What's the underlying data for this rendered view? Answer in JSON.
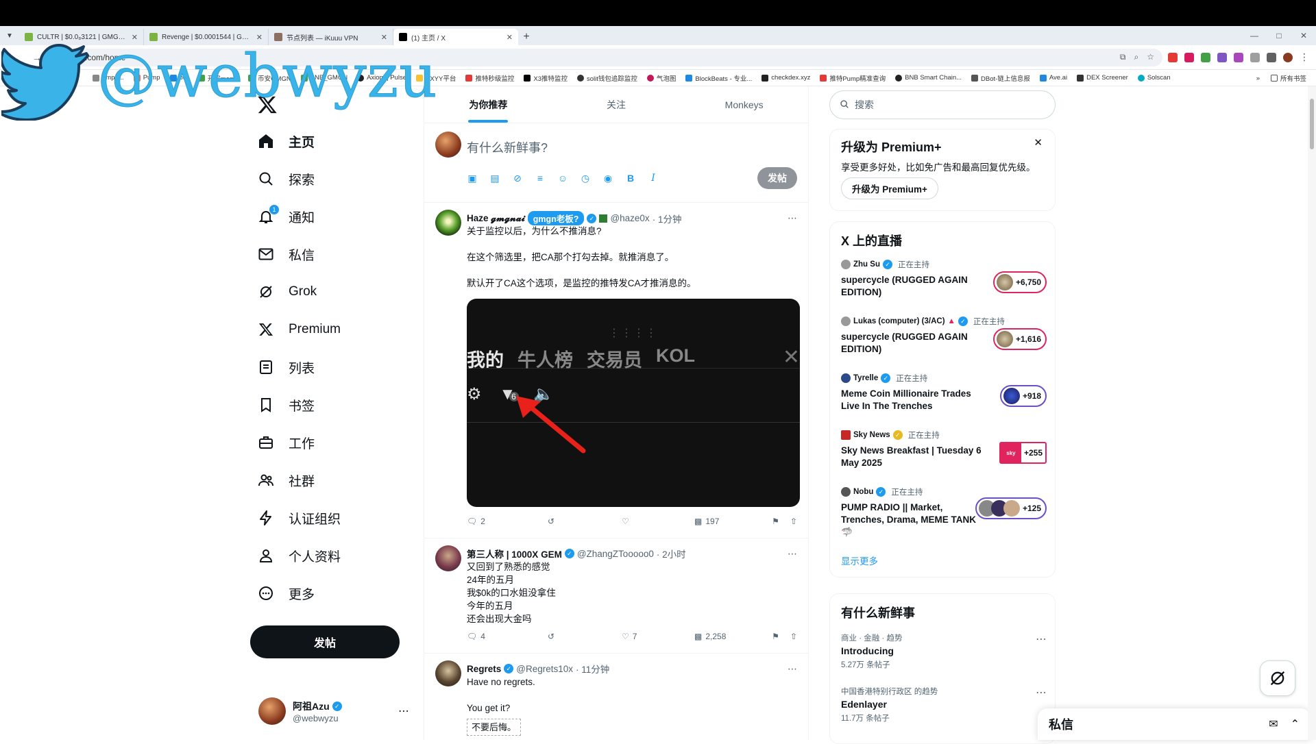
{
  "browser": {
    "tabs": [
      {
        "title": "CULTR | $0.0₈3121 | GMGN...",
        "color": "#7cb342"
      },
      {
        "title": "Revenge | $0.0001544 | GMG...",
        "color": "#7cb342"
      },
      {
        "title": "节点列表 — iKuuu VPN",
        "color": "#8d6e63"
      },
      {
        "title": "(1) 主页 / X",
        "color": "#000000"
      }
    ],
    "url": "x.com/home",
    "bookmarks": [
      "ump.f...",
      "Pump",
      "bot",
      "开扁meme",
      "币安GMGN",
      "BNB_GMGN",
      "Axiom | Pulse",
      "XXYY平台",
      "推特秒级监控",
      "X3推特监控",
      "solit钱包追踪监控",
      "气泡图",
      "BlockBeats - 专业...",
      "checkdex.xyz",
      "推特Pump精准查询",
      "BNB Smart Chain...",
      "DBot-链上信息报",
      "Ave.ai",
      "DEX Screener",
      "Solscan"
    ],
    "bookmarks_overflow": "»",
    "all_bookmarks": "所有书签"
  },
  "watermark": {
    "text": "@webwyzu"
  },
  "nav": {
    "items": [
      {
        "label": "主页",
        "icon": "home-icon",
        "active": true
      },
      {
        "label": "探索",
        "icon": "search-icon"
      },
      {
        "label": "通知",
        "icon": "bell-icon",
        "badge": "1"
      },
      {
        "label": "私信",
        "icon": "mail-icon"
      },
      {
        "label": "Grok",
        "icon": "grok-icon"
      },
      {
        "label": "Premium",
        "icon": "x-icon"
      },
      {
        "label": "列表",
        "icon": "list-icon"
      },
      {
        "label": "书签",
        "icon": "bookmark-icon"
      },
      {
        "label": "工作",
        "icon": "briefcase-icon"
      },
      {
        "label": "社群",
        "icon": "community-icon"
      },
      {
        "label": "认证组织",
        "icon": "lightning-icon"
      },
      {
        "label": "个人资料",
        "icon": "person-icon"
      },
      {
        "label": "更多",
        "icon": "more-circle-icon"
      }
    ],
    "post_button": "发帖",
    "profile": {
      "name": "阿祖Azu",
      "handle": "@webwyzu"
    }
  },
  "timeline": {
    "tabs": [
      "为你推荐",
      "关注",
      "Monkeys"
    ],
    "composer": {
      "placeholder": "有什么新鲜事?",
      "post": "发帖"
    },
    "tweets": [
      {
        "name": "Haze 𝓰𝓶𝓰𝓷𝓪𝓲",
        "tag": "gmgn老板?",
        "handle": "@haze0x",
        "time": "· 1分钟",
        "paras": [
          "关于监控以后，为什么不推消息?",
          "在这个筛选里，把CA那个打勾去掉。就推消息了。",
          "默认开了CA这个选项，是监控的推特发CA才推消息的。"
        ],
        "media": {
          "tabs": [
            "我的",
            "牛人榜",
            "交易员",
            "KOL"
          ],
          "filter_count": "6"
        },
        "replies": "2",
        "retweets": "",
        "likes": "",
        "views": "197"
      },
      {
        "name": "第三人称 | 1000X GEM",
        "handle": "@ZhangZTooooo0",
        "time": "· 2小时",
        "lines": [
          "又回到了熟悉的感觉",
          "24年的五月",
          "我$0k的口水姐没拿住",
          "今年的五月",
          "还会出现大金吗"
        ],
        "replies": "4",
        "retweets": "",
        "likes": "7",
        "views": "2,258"
      },
      {
        "name": "Regrets",
        "handle": "@Regrets10x",
        "time": "· 11分钟",
        "paras": [
          "Have no regrets.",
          "You get it?"
        ],
        "quote": "不要后悔。"
      }
    ]
  },
  "sidebar": {
    "search_placeholder": "搜索",
    "premium": {
      "title": "升级为 Premium+",
      "desc": "享受更多好处，比如免广告和最高回复优先级。",
      "button": "升级为 Premium+"
    },
    "live": {
      "title": "X 上的直播",
      "status": "正在主持",
      "items": [
        {
          "host": "Zhu Su",
          "title": "supercycle (RUGGED AGAIN EDITION)",
          "count": "+6,750"
        },
        {
          "host": "Lukas (computer) (3/AC)",
          "title": "supercycle (RUGGED AGAIN EDITION)",
          "count": "+1,616"
        },
        {
          "host": "Tyrelle",
          "title": "Meme Coin Millionaire Trades Live In The Trenches",
          "count": "+918"
        },
        {
          "host": "Sky News",
          "title": "Sky News Breakfast | Tuesday 6 May 2025",
          "count": "+255"
        },
        {
          "host": "Nobu",
          "title": "PUMP RADIO || Market, Trenches, Drama, MEME TANK 🦈",
          "count": "+125"
        }
      ],
      "show_more": "显示更多"
    },
    "trends": {
      "title": "有什么新鲜事",
      "items": [
        {
          "category": "商业 · 金融 · 趋势",
          "name": "Introducing",
          "count": "5.27万 条帖子"
        },
        {
          "category": "中国香港特别行政区 的趋势",
          "name": "Edenlayer",
          "count": "11.7万 条帖子"
        }
      ]
    }
  },
  "dm": {
    "title": "私信"
  }
}
